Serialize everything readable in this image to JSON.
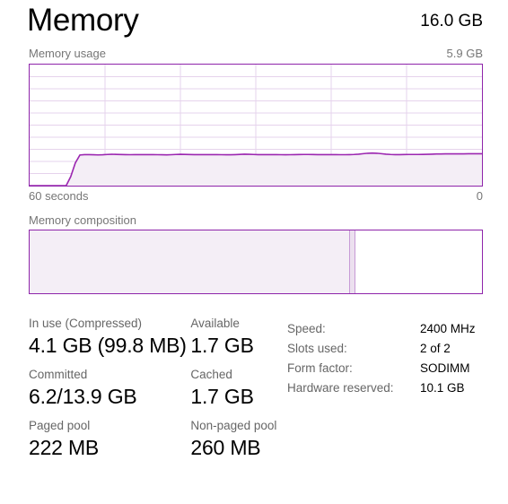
{
  "header": {
    "title": "Memory",
    "total": "16.0 GB"
  },
  "usage_graph": {
    "caption_left": "Memory usage",
    "caption_right": "5.9 GB",
    "axis_left": "60 seconds",
    "axis_right": "0",
    "border_color": "#8e24aa",
    "fill_color": "#f4eef6",
    "line_color": "#9b26b0"
  },
  "composition": {
    "caption": "Memory composition",
    "border_color": "#8e24aa",
    "in_use_fill": "#f4eef6",
    "divider_color": "#c79ad6"
  },
  "stats_left": [
    {
      "label_a": "In use (Compressed)",
      "value_a": "4.1 GB (99.8 MB)",
      "label_b": "Available",
      "value_b": "1.7 GB"
    },
    {
      "label_a": "Committed",
      "value_a": "6.2/13.9 GB",
      "label_b": "Cached",
      "value_b": "1.7 GB"
    },
    {
      "label_a": "Paged pool",
      "value_a": "222 MB",
      "label_b": "Non-paged pool",
      "value_b": "260 MB"
    }
  ],
  "stats_right": [
    {
      "key": "Speed:",
      "value": "2400 MHz"
    },
    {
      "key": "Slots used:",
      "value": "2 of 2"
    },
    {
      "key": "Form factor:",
      "value": "SODIMM"
    },
    {
      "key": "Hardware reserved:",
      "value": "10.1 GB"
    }
  ],
  "chart_data": {
    "type": "area",
    "title": "Memory usage",
    "xlabel": "",
    "ylabel": "",
    "ylim": [
      0,
      16.0
    ],
    "ymax_label": "5.9 GB",
    "x_axis_left_label": "60 seconds",
    "x_axis_right_label": "0",
    "grid": true,
    "grid_rows": 10,
    "grid_cols": 6,
    "legend": "none",
    "series": [
      {
        "name": "Memory usage",
        "units": "GB",
        "values": [
          0.0,
          0.0,
          0.0,
          0.0,
          0.0,
          0.0,
          0.0,
          0.0,
          0.0,
          1.2,
          3.0,
          4.05,
          4.1,
          4.1,
          4.08,
          4.06,
          4.08,
          4.12,
          4.14,
          4.13,
          4.11,
          4.1,
          4.09,
          4.1,
          4.1,
          4.1,
          4.1,
          4.1,
          4.09,
          4.08,
          4.07,
          4.09,
          4.12,
          4.14,
          4.13,
          4.11,
          4.1,
          4.1,
          4.1,
          4.1,
          4.1,
          4.1,
          4.09,
          4.08,
          4.08,
          4.1,
          4.13,
          4.15,
          4.14,
          4.12,
          4.1,
          4.1,
          4.1,
          4.1,
          4.1,
          4.09,
          4.08,
          4.09,
          4.1,
          4.11,
          4.12,
          4.12,
          4.11,
          4.1,
          4.1,
          4.1,
          4.1,
          4.1,
          4.09,
          4.09,
          4.1,
          4.12,
          4.16,
          4.22,
          4.28,
          4.3,
          4.28,
          4.22,
          4.16,
          4.12,
          4.1,
          4.1,
          4.11,
          4.12,
          4.12,
          4.12,
          4.13,
          4.14,
          4.16,
          4.18,
          4.19,
          4.2,
          4.2,
          4.2,
          4.2,
          4.2,
          4.21,
          4.22,
          4.22,
          4.22
        ]
      }
    ]
  }
}
